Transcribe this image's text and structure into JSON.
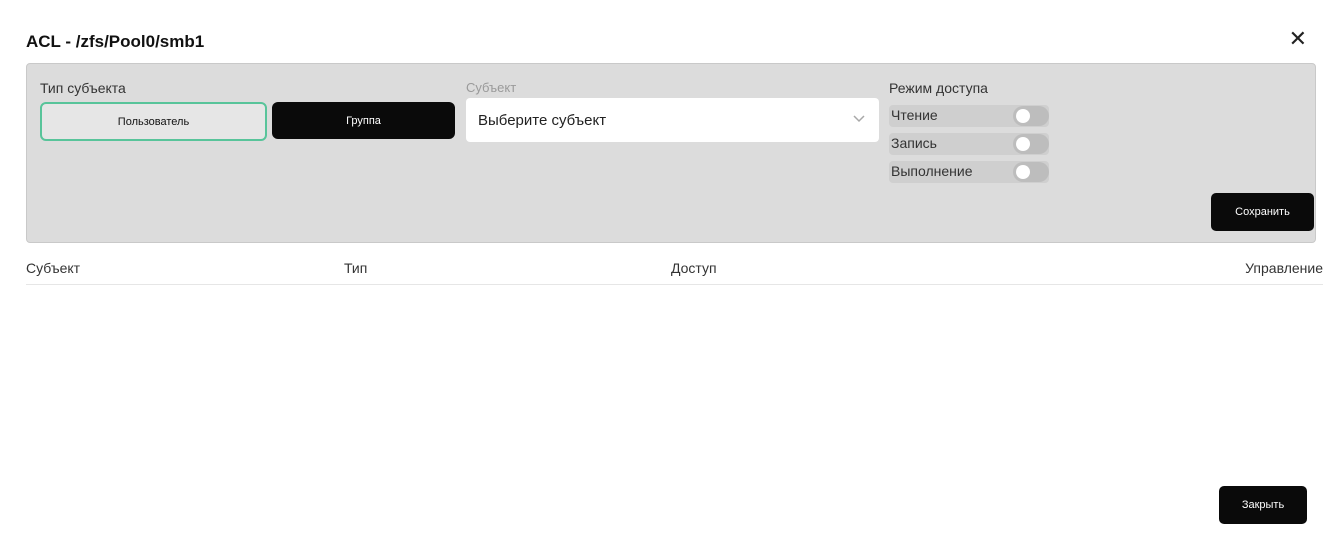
{
  "dialog": {
    "title": "ACL - /zfs/Pool0/smb1",
    "close_glyph": "✕"
  },
  "form": {
    "subject_type_label": "Тип субъекта",
    "user_button_label": "Пользователь",
    "group_button_label": "Группа",
    "selected_subject_type": "Пользователь",
    "subject_label": "Субъект",
    "subject_select_placeholder": "Выберите субъект",
    "access_mode_label": "Режим доступа",
    "permissions": [
      {
        "label": "Чтение",
        "enabled": false
      },
      {
        "label": "Запись",
        "enabled": false
      },
      {
        "label": "Выполнение",
        "enabled": false
      }
    ],
    "save_button_label": "Сохранить"
  },
  "table": {
    "columns": [
      "Субъект",
      "Тип",
      "Доступ",
      "Управление"
    ],
    "rows": []
  },
  "footer": {
    "close_button_label": "Закрыть"
  },
  "colors": {
    "panel_bg": "#dcdcdc",
    "selected_border": "#58c49a",
    "button_dark": "#0a0a0a"
  }
}
